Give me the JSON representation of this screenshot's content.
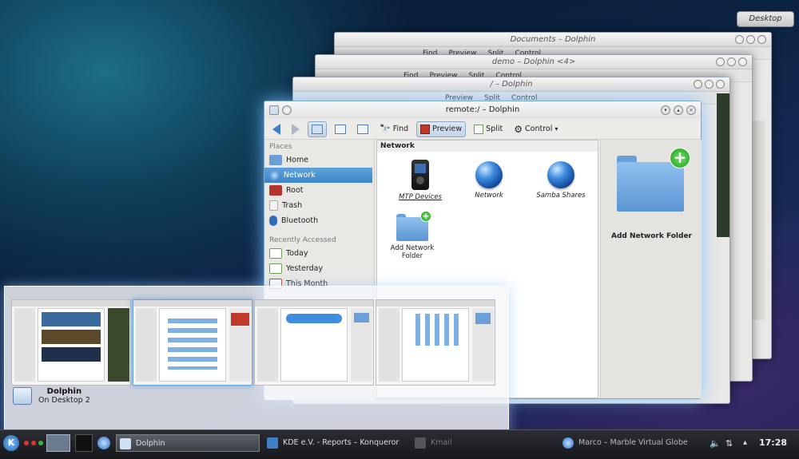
{
  "desktop_button": "Desktop",
  "background_windows": [
    {
      "title": "Documents – Dolphin",
      "toolbar": [
        "Find",
        "Preview",
        "Split",
        "Control"
      ]
    },
    {
      "title": "demo – Dolphin <4>",
      "toolbar": [
        "Find",
        "Preview",
        "Split",
        "Control"
      ]
    },
    {
      "title": "/ – Dolphin",
      "toolbar": [
        "Preview",
        "Split",
        "Control"
      ]
    }
  ],
  "main_window": {
    "title": "remote:/ – Dolphin",
    "toolbar": {
      "find": "Find",
      "preview": "Preview",
      "split": "Split",
      "control": "Control"
    },
    "places": {
      "title": "Places",
      "items": [
        "Home",
        "Network",
        "Root",
        "Trash",
        "Bluetooth"
      ],
      "selected": "Network",
      "recent_title": "Recently Accessed",
      "recent_items": [
        "Today",
        "Yesterday",
        "This Month"
      ]
    },
    "content": {
      "header": "Network",
      "items": [
        "MTP Devices",
        "Network",
        "Samba Shares",
        "Add Network Folder"
      ]
    },
    "info_panel": {
      "label": "Add Network Folder"
    }
  },
  "switcher": {
    "title": "Dolphin",
    "subtitle": "On Desktop 2"
  },
  "taskbar": {
    "tasks": [
      "Dolphin",
      "KDE e.V. - Reports – Konqueror",
      "Kmail",
      "Marco – Marble Virtual Globe"
    ],
    "clock": "17:28"
  },
  "colors": {
    "accent": "#3d85c6",
    "window_glow": "#78beff",
    "panel": "#1c1d21"
  }
}
